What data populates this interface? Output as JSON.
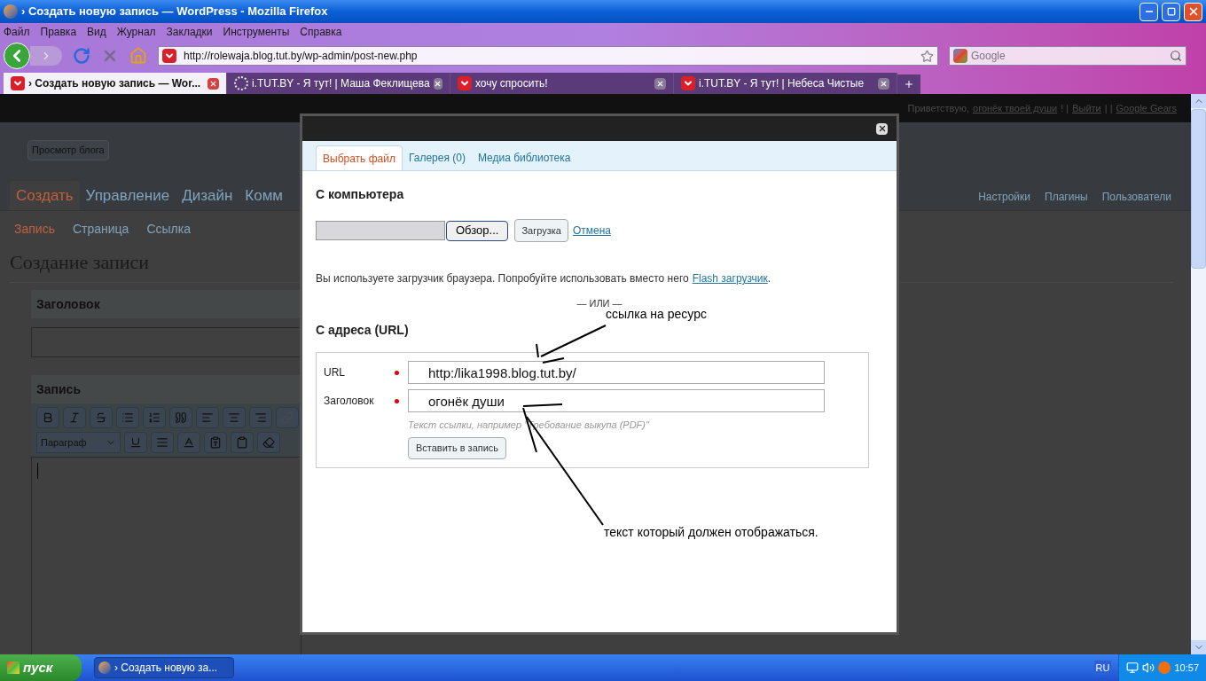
{
  "window": {
    "title": "› Создать новую запись — WordPress - Mozilla Firefox"
  },
  "menu": [
    "Файл",
    "Правка",
    "Вид",
    "Журнал",
    "Закладки",
    "Инструменты",
    "Справка"
  ],
  "address": {
    "url": "http://rolewaja.blog.tut.by/wp-admin/post-new.php"
  },
  "search": {
    "placeholder": "Google"
  },
  "tabs": [
    {
      "label": "› Создать новую запись — Wor...",
      "selected": true,
      "kind": "site"
    },
    {
      "label": "i.TUT.BY - Я тут! | Маша Феклищева",
      "selected": false,
      "kind": "loading"
    },
    {
      "label": "хочу спросить!",
      "selected": false,
      "kind": "site"
    },
    {
      "label": "i.TUT.BY - Я тут! | Небеса Чистые",
      "selected": false,
      "kind": "site"
    }
  ],
  "wp": {
    "user_bar": [
      {
        "kind": "text",
        "text": "Приветствую,"
      },
      {
        "kind": "link",
        "text": "огонёк твоей души"
      },
      {
        "kind": "text",
        "text": "! |"
      },
      {
        "kind": "link",
        "text": "Выйти"
      },
      {
        "kind": "text",
        "text": "| |"
      },
      {
        "kind": "link",
        "text": "Google Gears"
      }
    ],
    "view_blog": "Просмотр блога",
    "main_nav": [
      {
        "label": "Создать",
        "selected": true
      },
      {
        "label": "Управление",
        "selected": false
      },
      {
        "label": "Дизайн",
        "selected": false
      },
      {
        "label": "Комм",
        "selected": false
      }
    ],
    "right_nav": [
      "Настройки",
      "Плагины",
      "Пользователи"
    ],
    "sub_nav": [
      {
        "label": "Запись",
        "selected": true
      },
      {
        "label": "Страница",
        "selected": false
      },
      {
        "label": "Ссылка",
        "selected": false
      }
    ],
    "page_title": "Создание записи",
    "title_box": "Заголовок",
    "post_box": "Запись",
    "format_select": "Параграф"
  },
  "modal": {
    "tabs": [
      {
        "label": "Выбрать файл",
        "selected": true
      },
      {
        "label": "Галерея (0)",
        "selected": false
      },
      {
        "label": "Медиа библиотека",
        "selected": false
      }
    ],
    "computer_heading": "С компьютера",
    "browse": "Обзор...",
    "upload": "Загрузка",
    "cancel": "Отмена",
    "note": "Вы используете загрузчик браузера. Попробуйте использовать вместо него",
    "note_link": "Flash загрузчик",
    "note_end": ".",
    "or_text": "— ИЛИ —",
    "url_heading": "С адреса (URL)",
    "fields": [
      {
        "label": "URL",
        "required": true,
        "value": "http:/lika1998.blog.tut.by/"
      },
      {
        "label": "Заголовок",
        "required": true,
        "value": "огонёк души"
      }
    ],
    "hint": "Текст ссылки, например \"Требование выкупа (PDF)\"",
    "insert": "Вставить в запись"
  },
  "annotations": [
    "ссылка на ресурс",
    "текст который должен отображаться."
  ],
  "taskbar": {
    "start": "пуск",
    "task": "› Создать новую за...",
    "lang": "RU",
    "clock": "10:57"
  }
}
